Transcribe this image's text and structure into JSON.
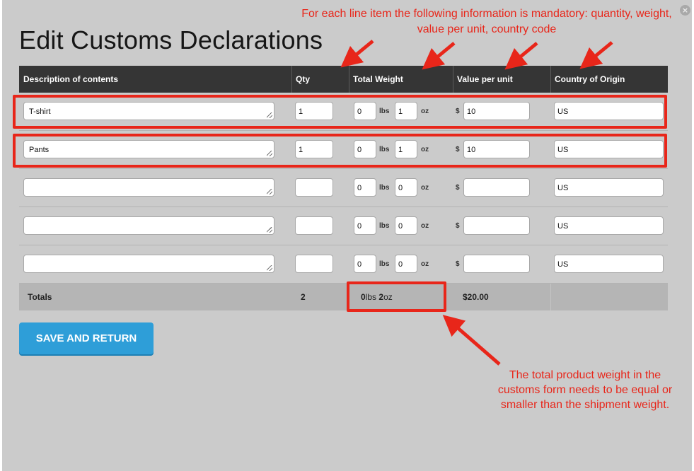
{
  "title": "Edit Customs Declarations",
  "annotations": {
    "top": "For each line item the following information is mandatory:  quantity, weight, value per unit, country code",
    "bottom": "The total product weight in the customs form needs to be equal or smaller than the shipment weight."
  },
  "close_label": "×",
  "columns": [
    "Description of contents",
    "Qty",
    "Total Weight",
    "Value per unit",
    "Country of Origin"
  ],
  "units": {
    "lbs": "lbs",
    "oz": "oz",
    "currency": "$"
  },
  "rows": [
    {
      "description": "T-shirt",
      "qty": "1",
      "lbs": "0",
      "oz": "1",
      "value": "10",
      "country": "US"
    },
    {
      "description": "Pants",
      "qty": "1",
      "lbs": "0",
      "oz": "1",
      "value": "10",
      "country": "US"
    },
    {
      "description": "",
      "qty": "",
      "lbs": "0",
      "oz": "0",
      "value": "",
      "country": "US"
    },
    {
      "description": "",
      "qty": "",
      "lbs": "0",
      "oz": "0",
      "value": "",
      "country": "US"
    },
    {
      "description": "",
      "qty": "",
      "lbs": "0",
      "oz": "0",
      "value": "",
      "country": "US"
    }
  ],
  "totals": {
    "label": "Totals",
    "qty": "2",
    "lbs": "0",
    "lbs_unit": "lbs",
    "oz": "2",
    "oz_unit": "oz",
    "value": "$20.00"
  },
  "save_button": "SAVE AND RETURN",
  "colors": {
    "annotation": "#e8261a",
    "header_bg": "#353535",
    "button": "#2e9ed8"
  }
}
